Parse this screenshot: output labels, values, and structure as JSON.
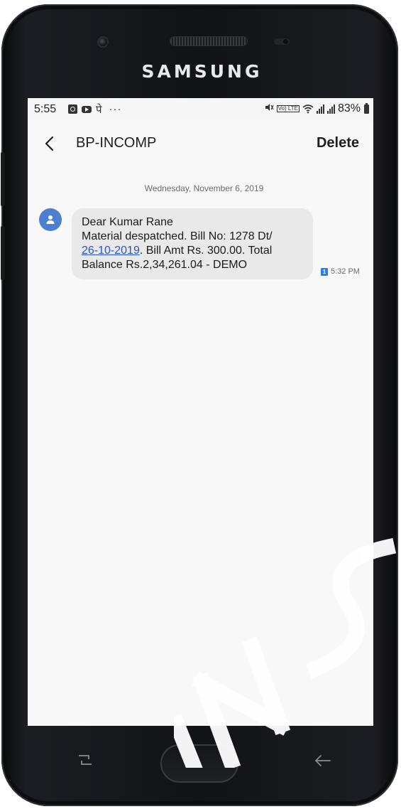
{
  "device": {
    "brand": "SAMSUNG"
  },
  "status_bar": {
    "time": "5:55",
    "notification_icons": [
      "q-app-icon",
      "youtube-icon",
      "devanagari-keyboard-icon",
      "more-notifications-icon"
    ],
    "devanagari_glyph": "पे",
    "more_glyph": "···",
    "right_icons": [
      "mute-icon",
      "volte-icon",
      "wifi-icon",
      "signal-icon",
      "signal-icon",
      "battery-icon"
    ],
    "volte_label": "Vo) LTE",
    "battery_percent": "83%"
  },
  "app_bar": {
    "title": "BP-INCOMP",
    "delete_label": "Delete"
  },
  "conversation": {
    "date": "Wednesday, November 6, 2019",
    "message": {
      "line1": "Dear Kumar Rane",
      "line2": "Material despatched. Bill No: 1278 Dt/",
      "line3_link": "26-10-2019",
      "line3_rest": ". Bill Amt Rs. 300.00. Total",
      "line4": "Balance Rs.2,34,261.04 - DEMO",
      "sim": "1",
      "time": "5:32 PM"
    }
  },
  "navigation": {
    "icons": [
      "recent-apps-icon",
      "home-button",
      "back-icon"
    ]
  },
  "colors": {
    "avatar": "#4a7fd1",
    "link": "#2b55c4",
    "sim_badge": "#2b7de9",
    "bubble": "#e9e9e9",
    "screen_bg": "#f8f8f8"
  }
}
